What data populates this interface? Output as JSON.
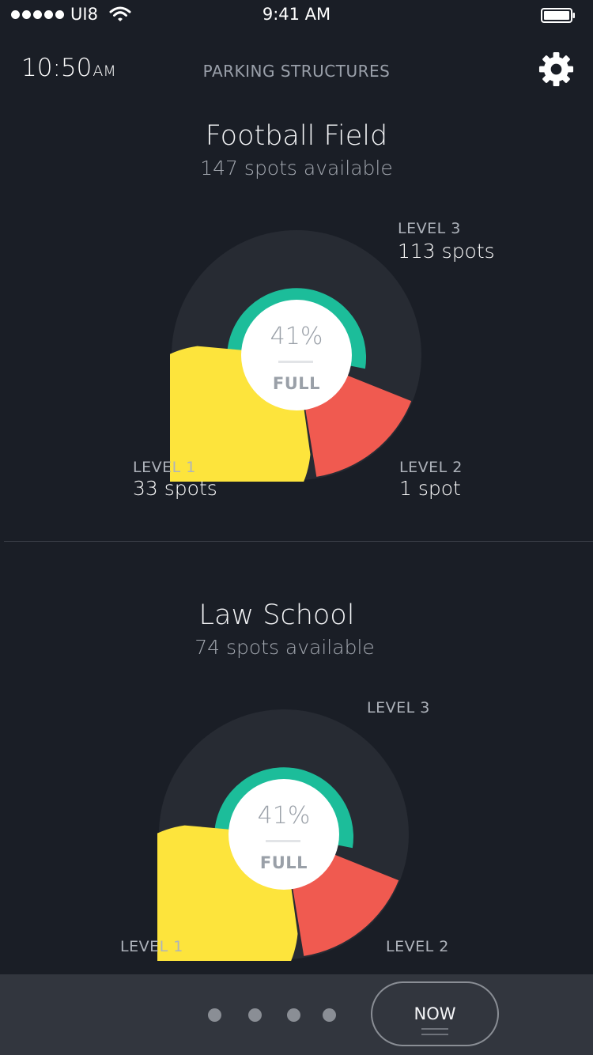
{
  "status_bar": {
    "carrier": "UI8",
    "time": "9:41 AM"
  },
  "header": {
    "local_time": "10:50",
    "local_ampm": "AM",
    "title": "PARKING STRUCTURES"
  },
  "structures": [
    {
      "name": "Football Field",
      "available": "147 spots available",
      "center_percent": "41%",
      "center_label": "FULL",
      "levels": [
        {
          "label": "LEVEL 1",
          "spots": "33 spots",
          "color": "#fde43c"
        },
        {
          "label": "LEVEL 2",
          "spots": "1 spot",
          "color": "#f05a50"
        },
        {
          "label": "LEVEL 3",
          "spots": "113 spots",
          "color": "#1cbd9a"
        }
      ]
    },
    {
      "name": "Law School",
      "available": "74 spots available",
      "center_percent": "41%",
      "center_label": "FULL",
      "levels": [
        {
          "label": "LEVEL 1",
          "color": "#fde43c"
        },
        {
          "label": "LEVEL 2",
          "color": "#f05a50"
        },
        {
          "label": "LEVEL 3",
          "color": "#1cbd9a"
        }
      ]
    }
  ],
  "bottom_bar": {
    "page_count": 4,
    "now_label": "NOW"
  },
  "colors": {
    "background": "#1a1e26",
    "chart_track": "#272b33",
    "bottom_bar": "#32363e"
  }
}
